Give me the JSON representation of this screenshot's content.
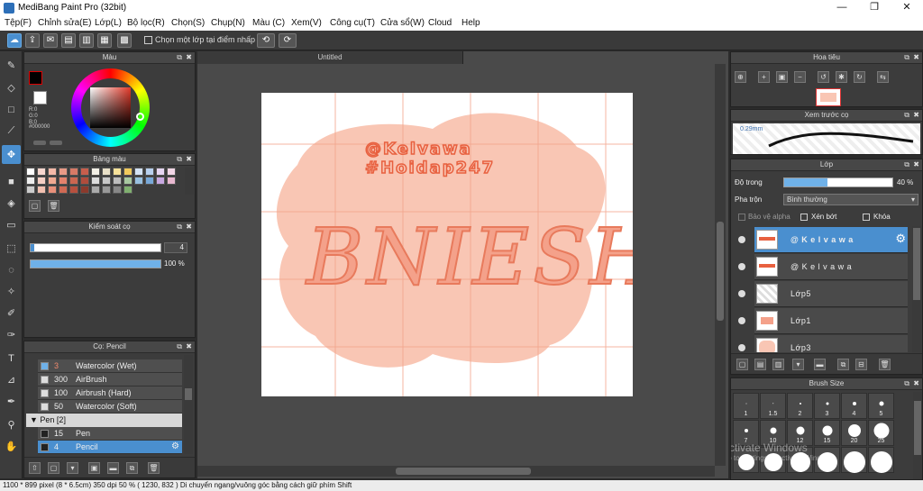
{
  "window": {
    "title": "MediBang Paint Pro (32bit)",
    "min_icon": "—",
    "max_icon": "❐",
    "close_icon": "✕"
  },
  "menu": [
    "Tệp(F)",
    "Chỉnh sửa(E)",
    "Lớp(L)",
    "Bộ lọc(R)",
    "Chọn(S)",
    "Chụp(N)",
    "Màu (C)",
    "Xem(V)",
    "Công cụ(T)",
    "Cửa sổ(W)",
    "Cloud",
    "Help"
  ],
  "toolbar": {
    "select_layer_label": "Chọn một lớp tại điểm nhấp",
    "undo_icon": "⟲",
    "redo_icon": "⟳"
  },
  "color_panel": {
    "title": "Màu",
    "r": "R:0",
    "g": "G:0",
    "b": "B:0",
    "hex": "#000000"
  },
  "palette_panel": {
    "title": "Bảng màu"
  },
  "brush_control": {
    "title": "Kiểm soát cọ",
    "size": "4",
    "opacity": "100 %"
  },
  "brush_panel": {
    "title": "Cọ: Pencil",
    "items": [
      {
        "num": "3",
        "name": "Watercolor (Wet)"
      },
      {
        "num": "300",
        "name": "AirBrush"
      },
      {
        "num": "100",
        "name": "Airbrush (Hard)"
      },
      {
        "num": "50",
        "name": "Watercolor (Soft)"
      }
    ],
    "group": "Pen [2]",
    "pen_items": [
      {
        "num": "15",
        "name": "Pen"
      },
      {
        "num": "4",
        "name": "Pencil"
      }
    ]
  },
  "document": {
    "tab": "Untitled"
  },
  "artwork": {
    "line1": "@Kelvawa",
    "line2": "#Hoidap247",
    "big_text": "BNIESH"
  },
  "navigator": {
    "title": "Hoa tiêu"
  },
  "brush_preview": {
    "title": "Xem trước cọ",
    "size": "0.29mm"
  },
  "layers": {
    "title": "Lớp",
    "opacity_label": "Độ trong",
    "opacity_value": "40 %",
    "opacity_fraction": 0.4,
    "blend_label": "Pha trộn",
    "blend_value": "Bình thường",
    "protect_alpha": "Bảo vệ alpha",
    "clipping": "Xén bớt",
    "lock": "Khóa",
    "items": [
      {
        "name": "@ K e l v a w a",
        "selected": true
      },
      {
        "name": "@ K e l v a w a",
        "selected": false
      },
      {
        "name": "Lớp5",
        "selected": false
      },
      {
        "name": "Lớp1",
        "selected": false
      },
      {
        "name": "Lớp3",
        "selected": false
      }
    ]
  },
  "brush_size": {
    "title": "Brush Size",
    "sizes": [
      "1",
      "1.5",
      "2",
      "3",
      "4",
      "5",
      "7",
      "10",
      "12",
      "15",
      "20",
      "25"
    ]
  },
  "watermark": {
    "line1": "Activate Windows",
    "line2": "Go to Settings to activate Windows."
  },
  "status": "1100 * 899 pixel  (8 * 6.5cm)  350 dpi  50 %  ( 1230, 832 )  Di chuyển ngang/vuông góc bằng cách giữ phím Shift",
  "colors": {
    "accent": "#4a8fcf",
    "blob": "#f9c6b4",
    "lettering": "#f08a6e"
  }
}
